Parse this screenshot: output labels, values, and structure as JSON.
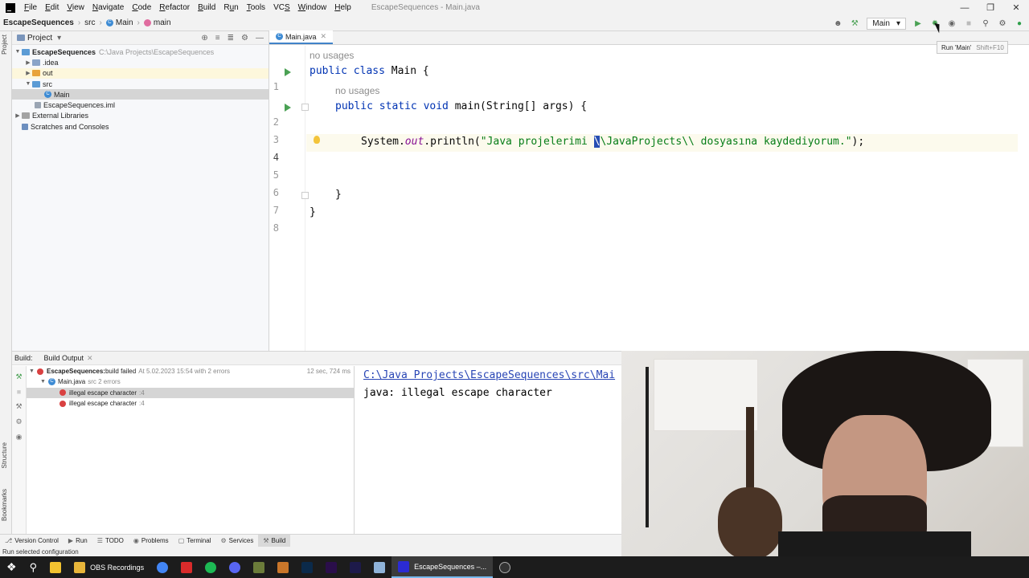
{
  "window": {
    "title": "EscapeSequences - Main.java"
  },
  "menu": [
    {
      "pre": "",
      "u": "F",
      "post": "ile"
    },
    {
      "pre": "",
      "u": "E",
      "post": "dit"
    },
    {
      "pre": "",
      "u": "V",
      "post": "iew"
    },
    {
      "pre": "",
      "u": "N",
      "post": "avigate"
    },
    {
      "pre": "",
      "u": "C",
      "post": "ode"
    },
    {
      "pre": "",
      "u": "R",
      "post": "efactor"
    },
    {
      "pre": "",
      "u": "B",
      "post": "uild"
    },
    {
      "pre": "R",
      "u": "u",
      "post": "n"
    },
    {
      "pre": "",
      "u": "T",
      "post": "ools"
    },
    {
      "pre": "VC",
      "u": "S",
      "post": ""
    },
    {
      "pre": "",
      "u": "W",
      "post": "indow"
    },
    {
      "pre": "",
      "u": "H",
      "post": "elp"
    }
  ],
  "breadcrumb": {
    "project": "EscapeSequences",
    "src": "src",
    "class": "Main",
    "method": "main"
  },
  "run_config": {
    "label": "Main"
  },
  "tooltip": {
    "text": "Run 'Main'",
    "shortcut": "Shift+F10"
  },
  "project_panel": {
    "title": "Project",
    "tree": [
      {
        "label": "EscapeSequences",
        "extra": "C:\\Java Projects\\EscapeSequences"
      },
      {
        "label": ".idea"
      },
      {
        "label": "out"
      },
      {
        "label": "src"
      },
      {
        "label": "Main"
      },
      {
        "label": "EscapeSequences.iml"
      },
      {
        "label": "External Libraries"
      },
      {
        "label": "Scratches and Consoles"
      }
    ]
  },
  "editor": {
    "tab": "Main.java",
    "usage_hint": "no usages",
    "lines": [
      "1",
      "2",
      "3",
      "4",
      "5",
      "6",
      "7",
      "8"
    ],
    "code": {
      "l1_kw": "public class",
      "l1_rest": " Main {",
      "l2_kw": "public static void",
      "l2_rest": " main(String[] args) {",
      "l4_pre": "System.",
      "l4_field": "out",
      "l4_mid": ".println(",
      "l4_str1": "\"Java projelerimi ",
      "l4_caret": "\\",
      "l4_str2": "\\JavaProjects\\\\ dosyasına kaydediyorum.\"",
      "l4_end": ");",
      "l7": "}",
      "l8": "}"
    }
  },
  "build_panel": {
    "label": "Build:",
    "tab": "Build Output",
    "rows": [
      {
        "bold": "EscapeSequences:",
        "text": " build failed",
        "dim": "At 5.02.2023 15:54 with 2 errors",
        "time": "12 sec, 724 ms"
      },
      {
        "text": "Main.java",
        "dim": "src 2 errors"
      },
      {
        "text": "illegal escape character",
        "dim": ":4"
      },
      {
        "text": "illegal escape character",
        "dim": ":4"
      }
    ],
    "output_path": "C:\\Java Projects\\EscapeSequences\\src\\Mai",
    "output_msg": "java: illegal escape character"
  },
  "side_tabs": {
    "project": "Project",
    "structure": "Structure",
    "bookmarks": "Bookmarks"
  },
  "bottom_tabs": [
    "Version Control",
    "Run",
    "TODO",
    "Problems",
    "Terminal",
    "Services",
    "Build"
  ],
  "status": {
    "text": "Run selected configuration"
  },
  "taskbar": {
    "obs": "OBS Recordings",
    "ide": "EscapeSequences –..."
  },
  "colors": {
    "keyword": "#0033b3",
    "string": "#067d17",
    "field": "#871094",
    "error": "#d94141",
    "run": "#4aa154"
  }
}
